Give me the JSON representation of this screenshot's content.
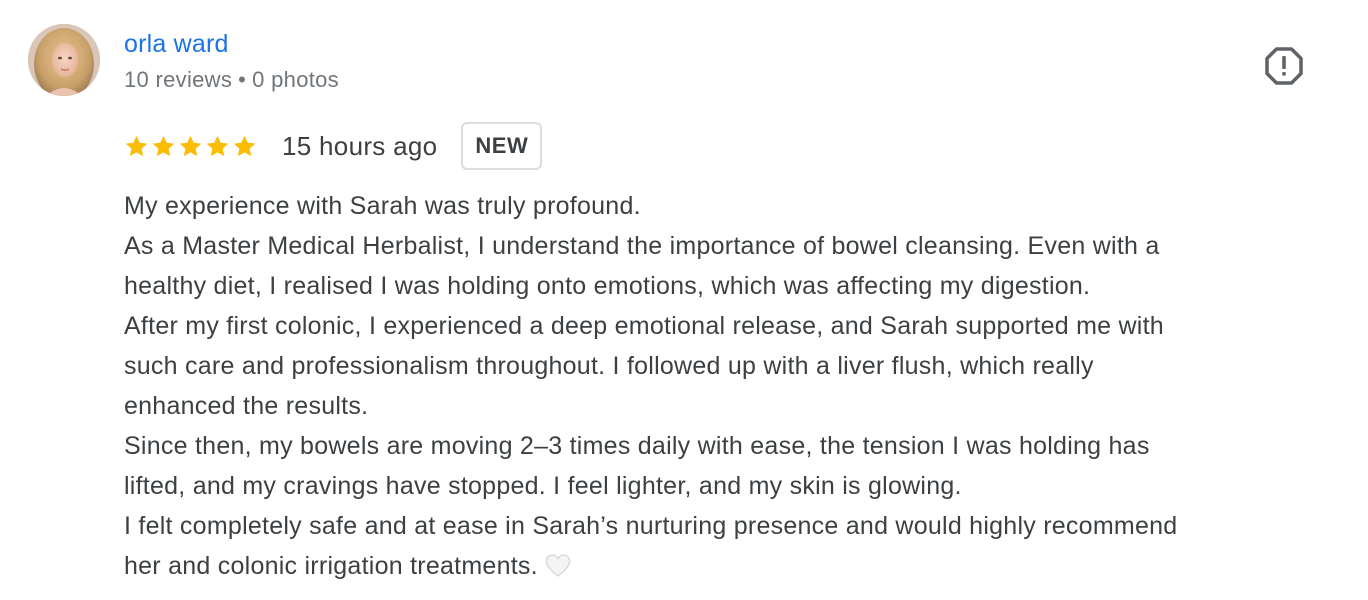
{
  "reviewer": {
    "name": "orla ward",
    "reviews_count": "10 reviews",
    "separator": "•",
    "photos_count": "0 photos",
    "avatar_icon": "user-photo"
  },
  "review": {
    "rating": 5,
    "max_rating": 5,
    "star_color": "#fbbc04",
    "time": "15 hours ago",
    "badge": "NEW",
    "lines": [
      "My experience with Sarah was truly profound.",
      "As a Master Medical Herbalist, I understand the importance of bowel cleansing. Even with a",
      "healthy diet, I realised I was holding onto emotions, which was affecting my digestion.",
      "After my first colonic, I experienced a deep emotional release, and Sarah supported me with",
      "such care and professionalism throughout. I followed up with a liver flush, which really",
      "enhanced the results.",
      "Since then, my bowels are moving 2–3 times daily with ease, the tension I was holding has",
      "lifted, and my cravings have stopped. I feel lighter, and my skin is glowing.",
      "I felt completely safe and at ease in Sarah’s nurturing presence and would highly recommend",
      "her and colonic irrigation treatments."
    ],
    "emoji": "white-heart-icon"
  },
  "actions": {
    "report_icon": "report-icon"
  },
  "colors": {
    "name_link": "#1a73e8",
    "meta_text": "#70757a",
    "body_text": "#3c4043",
    "badge_border": "#dadce0"
  }
}
